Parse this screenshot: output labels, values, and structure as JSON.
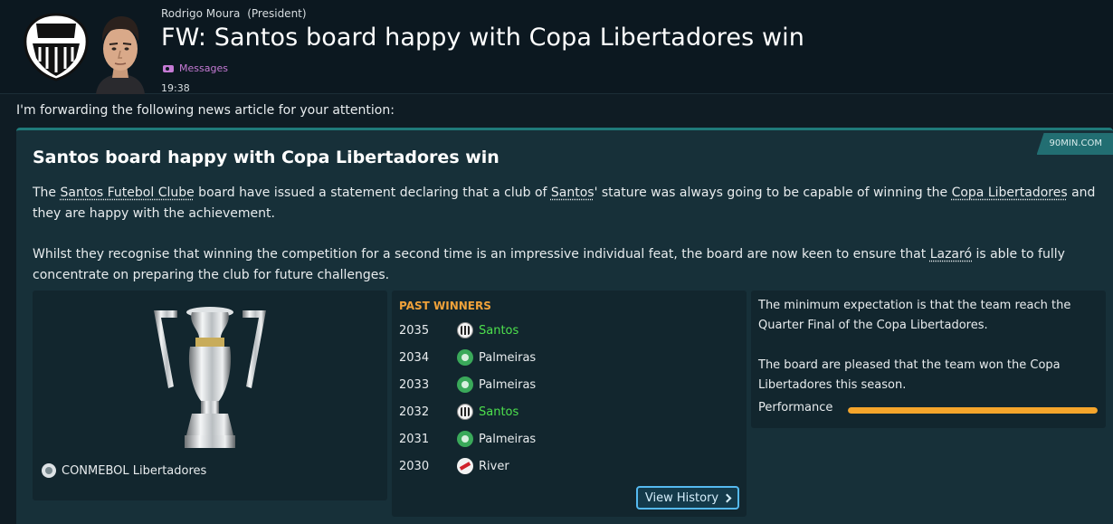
{
  "header": {
    "sender_name": "Rodrigo Moura",
    "sender_role": "(President)",
    "title": "FW: Santos board happy with Copa Libertadores win",
    "tag": "Messages",
    "time": "19:38"
  },
  "intro": "I'm forwarding the following news article for your attention:",
  "article": {
    "source": "90MIN.COM",
    "title": "Santos board happy with Copa Libertadores win",
    "p1": {
      "t1": "The ",
      "club": "Santos Futebol Clube",
      "t2": " board have issued a statement declaring that a club of ",
      "club_short": "Santos",
      "t3": "' stature was always going to be capable of winning the ",
      "competition": "Copa Libertadores",
      "t4": " and they are happy with the achievement."
    },
    "p2": {
      "t1": "Whilst they recognise that winning the competition for a second time is an impressive individual feat, the board are now keen to ensure that ",
      "manager": "Lazaró",
      "t2": " is able to fully concentrate on preparing the club for future challenges."
    }
  },
  "trophy_panel": {
    "competition_name": "CONMEBOL Libertadores"
  },
  "past_winners": {
    "title": "PAST WINNERS",
    "rows": [
      {
        "year": "2035",
        "team": "Santos"
      },
      {
        "year": "2034",
        "team": "Palmeiras"
      },
      {
        "year": "2033",
        "team": "Palmeiras"
      },
      {
        "year": "2032",
        "team": "Santos"
      },
      {
        "year": "2031",
        "team": "Palmeiras"
      },
      {
        "year": "2030",
        "team": "River"
      }
    ],
    "button_label": "View History"
  },
  "expectation": {
    "line1": "The minimum expectation is that the team reach the Quarter Final of the Copa Libertadores.",
    "line2": "The board are pleased that the team won the Copa Libertadores this season.",
    "performance_label": "Performance",
    "performance_value": 1.0
  },
  "colors": {
    "accent_teal": "#1f7a7a",
    "past_winners_heading": "#f0a23a",
    "highlight_team": "#4de04d",
    "performance_bar": "#f5a52b",
    "button_border": "#55b9f0",
    "tag": "#c57ad4"
  }
}
